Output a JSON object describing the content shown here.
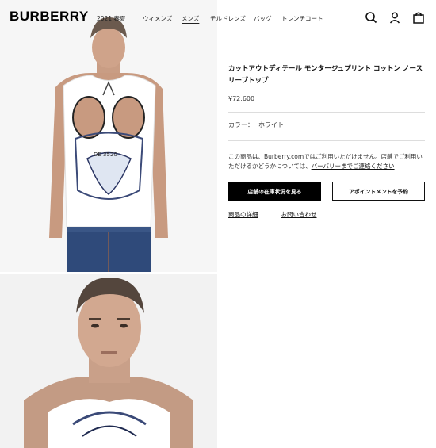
{
  "brand": {
    "logo_text": "BURBERRY"
  },
  "nav": {
    "items": [
      {
        "label": "2021 春夏",
        "active": false
      },
      {
        "label": "ウィメンズ",
        "active": false
      },
      {
        "label": "メンズ",
        "active": true
      },
      {
        "label": "チルドレンズ",
        "active": false
      },
      {
        "label": "バッグ",
        "active": false
      },
      {
        "label": "トレンチコート",
        "active": false
      }
    ],
    "icons": [
      "search-icon",
      "account-icon",
      "bag-icon"
    ]
  },
  "product": {
    "title": "カットアウトディテール モンタージュプリント コットン ノースリーブトップ",
    "price": "¥72,600",
    "color_label": "カラー：",
    "color_value": "ホワイト",
    "notice_text": "この商品は、Burberry.comではご利用いただけません。店舗でご利用いただけるかどうかについては、",
    "notice_link": "バーバリーまでご連絡ください",
    "primary_button": "店舗の在庫状況を見る",
    "secondary_button": "アポイントメントを予約",
    "details_link": "商品の詳細",
    "inquiry_link": "お問い合わせ"
  },
  "colors": {
    "primary": "#000000",
    "text": "#111111",
    "divider": "#dddddd"
  }
}
